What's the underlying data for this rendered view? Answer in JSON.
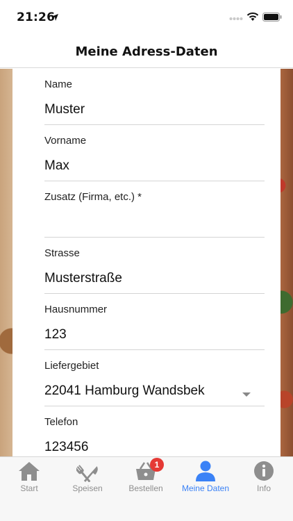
{
  "status_bar": {
    "time": "21:26"
  },
  "nav": {
    "title": "Meine Adress-Daten"
  },
  "form": {
    "fields": [
      {
        "label": "Name",
        "value": "Muster"
      },
      {
        "label": "Vorname",
        "value": "Max"
      },
      {
        "label": "Zusatz (Firma, etc.) *",
        "value": ""
      },
      {
        "label": "Strasse",
        "value": "Musterstraße"
      },
      {
        "label": "Hausnummer",
        "value": "123"
      },
      {
        "label": "Liefergebiet",
        "value": "22041 Hamburg Wandsbek"
      },
      {
        "label": "Telefon",
        "value": "123456"
      }
    ]
  },
  "tabs": [
    {
      "label": "Start",
      "icon": "home-icon"
    },
    {
      "label": "Speisen",
      "icon": "cutlery-icon"
    },
    {
      "label": "Bestellen",
      "icon": "basket-icon",
      "badge": "1"
    },
    {
      "label": "Meine Daten",
      "icon": "person-icon",
      "active": true
    },
    {
      "label": "Info",
      "icon": "info-icon"
    }
  ],
  "colors": {
    "accent": "#3b82f6",
    "inactive": "#8e8e8e",
    "badge": "#e53935"
  }
}
